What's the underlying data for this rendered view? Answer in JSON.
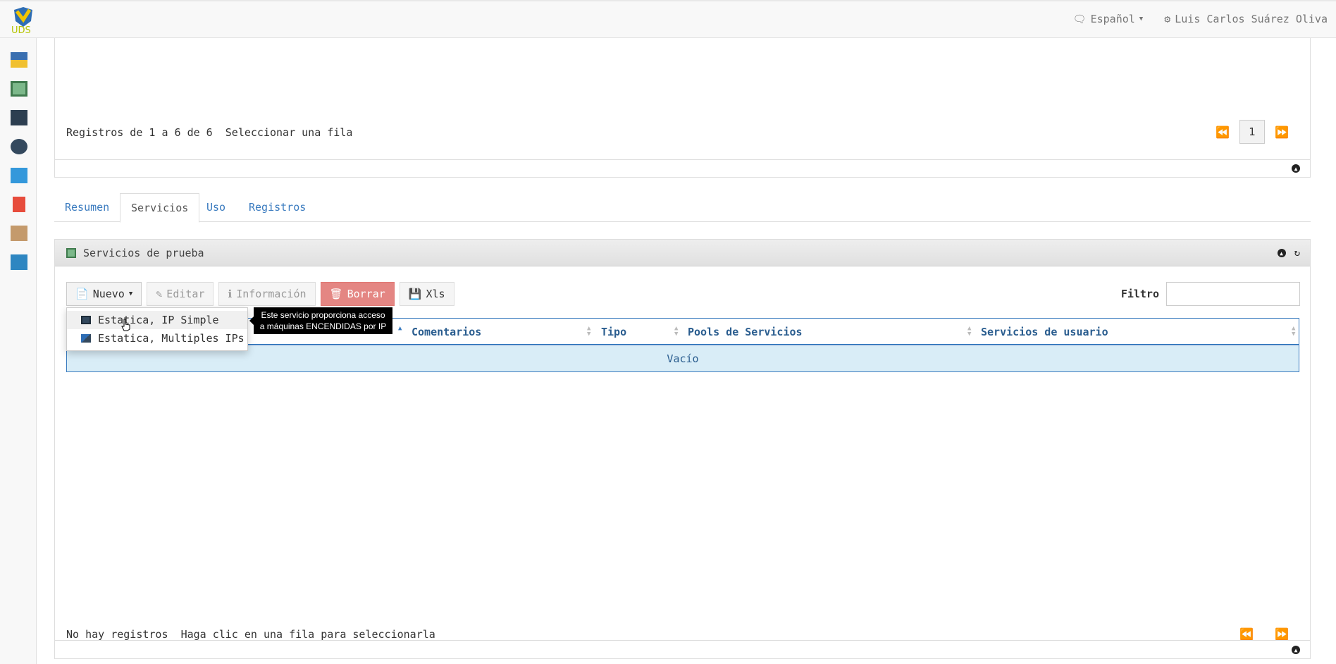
{
  "header": {
    "logo_text": "UDS",
    "language": "Español",
    "user": "Luis Carlos Suárez Oliva"
  },
  "sidebar": {
    "icons": [
      "dashboard-icon",
      "services-icon",
      "authenticators-icon",
      "osmanagers-icon",
      "connectivity-icon",
      "reports-icon",
      "scheduler-icon",
      "tools-icon"
    ]
  },
  "top_panel": {
    "records_text": "Registros de 1 a 6 de 6",
    "select_hint": "Seleccionar una fila",
    "page": "1"
  },
  "tabs": [
    {
      "label": "Resumen"
    },
    {
      "label": "Servicios"
    },
    {
      "label": "Uso"
    },
    {
      "label": "Registros"
    }
  ],
  "services_panel": {
    "title": "Servicios de prueba",
    "toolbar": {
      "new_label": "Nuevo",
      "edit_label": "Editar",
      "info_label": "Información",
      "delete_label": "Borrar",
      "xls_label": "Xls"
    },
    "filter_label": "Filtro",
    "filter_value": "",
    "columns": [
      "Comentarios",
      "Tipo",
      "Pools de Servicios",
      "Servicios de usuario"
    ],
    "empty_text": "Vacío",
    "footer_text": "No hay registros",
    "footer_hint": "Haga clic en una fila para seleccionarla"
  },
  "dropdown": {
    "items": [
      {
        "label": "Estatica, IP Simple"
      },
      {
        "label": "Estatica, Multiples IPs"
      }
    ]
  },
  "tooltip": {
    "line1": "Este servicio proporciona acceso",
    "line2": "a máquinas ENCENDIDAS por IP"
  }
}
